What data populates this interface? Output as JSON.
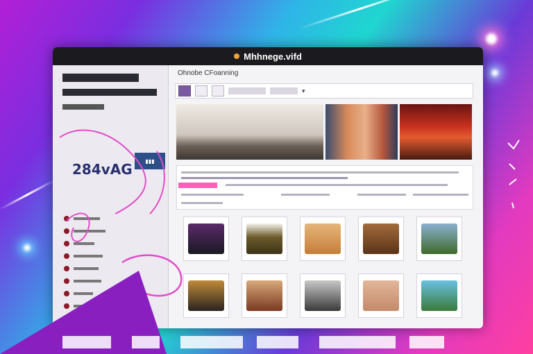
{
  "window": {
    "title": "Mhhnege.vifd",
    "app_header": "Ohnobe CFoanning",
    "big_number": "284vAG",
    "colors": {
      "titlebar": "#1b1b1f",
      "accent": "#ff5fb8",
      "badge": "#2c4f8a"
    }
  },
  "icons": [
    "app-dot-icon",
    "search-icon",
    "filter-icon",
    "chevron-down-icon",
    "menu-icon"
  ]
}
